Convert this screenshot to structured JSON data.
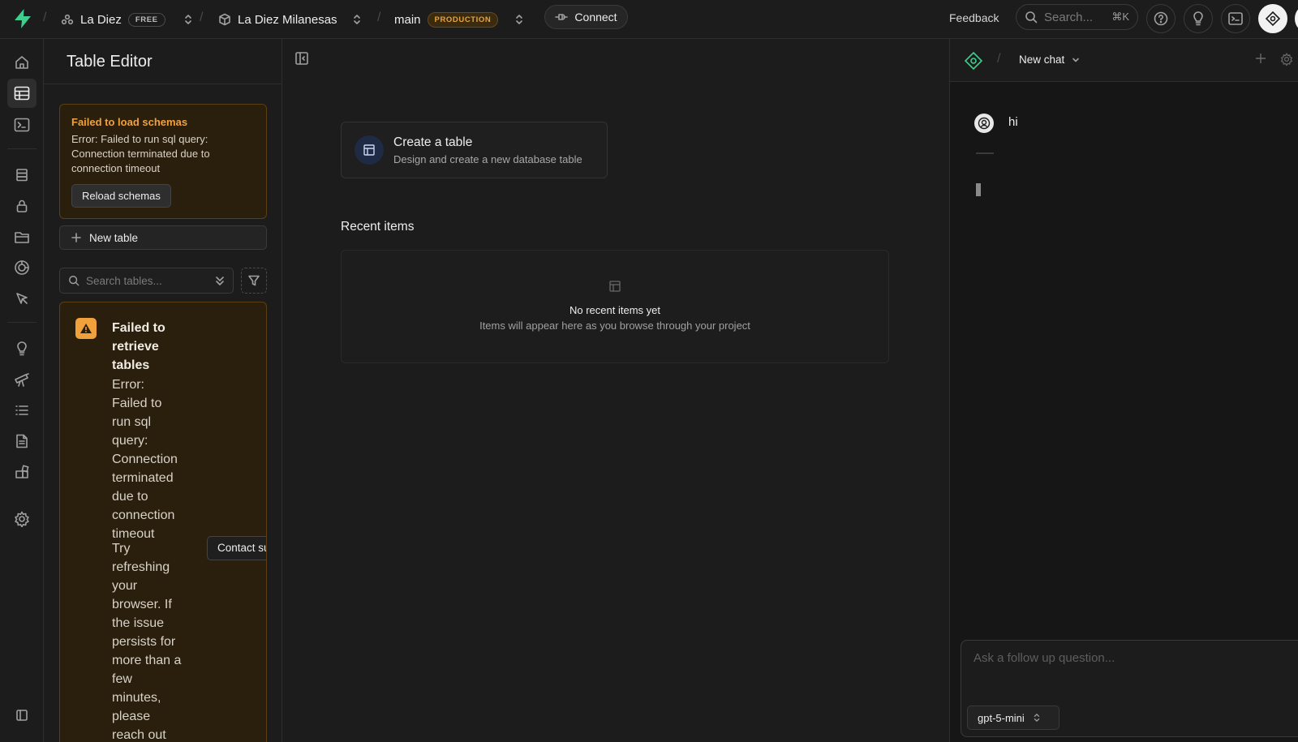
{
  "topbar": {
    "org_name": "La Diez",
    "org_plan": "FREE",
    "project_name": "La Diez Milanesas",
    "branch_name": "main",
    "branch_env": "PRODUCTION",
    "connect_label": "Connect",
    "feedback_label": "Feedback",
    "search_placeholder": "Search...",
    "search_shortcut": "⌘K"
  },
  "sidebar": {
    "title": "Table Editor",
    "schema_error": {
      "title": "Failed to load schemas",
      "message": "Error: Failed to run sql query: Connection terminated due to connection timeout",
      "button": "Reload schemas"
    },
    "new_table_label": "New table",
    "search_placeholder": "Search tables...",
    "tables_error": {
      "title": "Failed to retrieve tables",
      "message": "Error: Failed to run sql query: Connection terminated due to connection timeout",
      "hint": "Try refreshing your browser. If the issue persists for more than a few minutes, please reach out",
      "contact_label": "Contact support"
    }
  },
  "main": {
    "create": {
      "title": "Create a table",
      "subtitle": "Design and create a new database table"
    },
    "recent": {
      "title": "Recent items",
      "empty_title": "No recent items yet",
      "empty_subtitle": "Items will appear here as you browse through your project"
    }
  },
  "assistant": {
    "chat_title": "New chat",
    "messages": [
      {
        "role": "user",
        "text": "hi"
      }
    ],
    "composer_placeholder": "Ask a follow up question...",
    "model": "gpt-5-mini"
  },
  "colors": {
    "background": "#1c1c1c",
    "brand": "#3ecf8e",
    "warning": "#f1a13b",
    "warning_bg": "#2a1f0d"
  }
}
